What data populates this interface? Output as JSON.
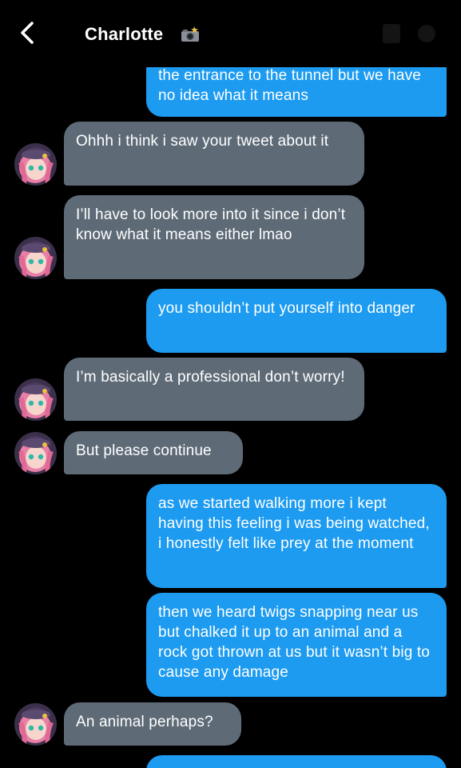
{
  "header": {
    "contact_name": "Charlotte",
    "name_emoji": "camera-with-flash-icon"
  },
  "messages": [
    {
      "side": "out",
      "text": "the entrance to the tunnel but we have no idea what it means"
    },
    {
      "side": "in",
      "text": "Ohhh i think i saw your tweet about it"
    },
    {
      "side": "in",
      "text": "I’ll have to look more into it since i don’t know what it means either lmao"
    },
    {
      "side": "out",
      "text": "you shouldn’t put yourself into danger"
    },
    {
      "side": "in",
      "text": "I’m basically a professional don’t worry!"
    },
    {
      "side": "in",
      "text": "But please continue"
    },
    {
      "side": "out",
      "text": "as we started walking more i kept having this feeling i was being watched, i honestly felt like prey at the moment"
    },
    {
      "side": "out",
      "text": "then we heard twigs snapping near us but chalked it up to an animal and a rock got thrown at us but it wasn’t big to cause any damage"
    },
    {
      "side": "in",
      "text": "An animal perhaps?"
    },
    {
      "side": "out",
      "text": ""
    }
  ],
  "colors": {
    "background": "#000000",
    "outgoing_bubble": "#1d9bf0",
    "incoming_bubble": "#5e6b77",
    "text": "#ffffff"
  }
}
